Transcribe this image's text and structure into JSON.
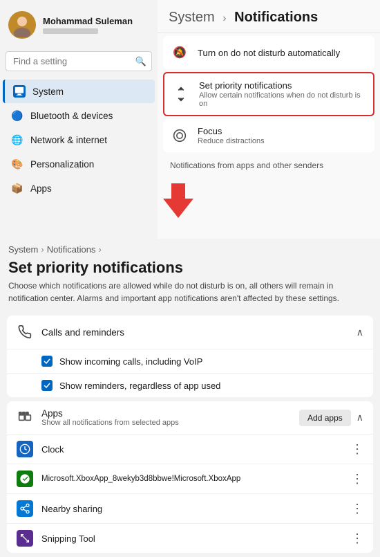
{
  "user": {
    "name": "Mohammad Suleman",
    "sub_placeholder": "account info"
  },
  "search": {
    "placeholder": "Find a setting"
  },
  "sidebar": {
    "items": [
      {
        "id": "system",
        "label": "System",
        "active": true
      },
      {
        "id": "bluetooth",
        "label": "Bluetooth & devices"
      },
      {
        "id": "network",
        "label": "Network & internet"
      },
      {
        "id": "personalization",
        "label": "Personalization"
      },
      {
        "id": "apps",
        "label": "Apps"
      }
    ]
  },
  "top_section": {
    "breadcrumb_system": "System",
    "breadcrumb_sep": "›",
    "breadcrumb_current": "Notifications",
    "settings": [
      {
        "id": "dnd",
        "icon": "🔕",
        "title": "Turn on do not disturb automatically",
        "sub": "",
        "highlighted": false
      },
      {
        "id": "priority",
        "icon": "↕",
        "title": "Set priority notifications",
        "sub": "Allow certain notifications when do not disturb is on",
        "highlighted": true
      },
      {
        "id": "focus",
        "icon": "◎",
        "title": "Focus",
        "sub": "Reduce distractions",
        "highlighted": false
      }
    ],
    "section_label": "Notifications from apps and other senders"
  },
  "bottom_section": {
    "breadcrumb": {
      "system": "System",
      "sep1": "›",
      "notifications": "Notifications",
      "sep2": "›",
      "current": "Set priority notifications"
    },
    "description": "Choose which notifications are allowed while do not disturb is on, all others will remain in notification center. Alarms and important app notifications aren't affected by these settings.",
    "calls_section": {
      "icon": "📞",
      "title": "Calls and reminders",
      "checkboxes": [
        {
          "label": "Show incoming calls, including VoIP",
          "checked": true
        },
        {
          "label": "Show reminders, regardless of app used",
          "checked": true
        }
      ]
    },
    "apps_section": {
      "title": "Apps",
      "sub": "Show all notifications from selected apps",
      "add_apps_label": "Add apps",
      "apps": [
        {
          "id": "clock",
          "icon": "🕐",
          "name": "Clock",
          "color": "#1565c0"
        },
        {
          "id": "xbox",
          "icon": "🎮",
          "name": "Microsoft.XboxApp_8wekyb3d8bbwe!Microsoft.XboxApp",
          "color": "#107c10"
        },
        {
          "id": "nearby",
          "icon": "🔗",
          "name": "Nearby sharing",
          "color": "#0078d4"
        },
        {
          "id": "snipping",
          "icon": "✂",
          "name": "Snipping Tool",
          "color": "#5c2d91"
        }
      ]
    }
  }
}
